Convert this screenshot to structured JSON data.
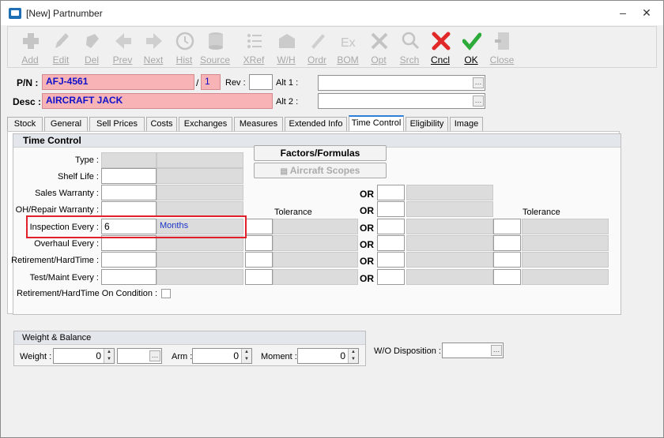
{
  "window": {
    "title": "[New] Partnumber"
  },
  "toolbar": {
    "buttons": [
      {
        "label": "Add",
        "icon": "add-icon"
      },
      {
        "label": "Edit",
        "icon": "edit-icon"
      },
      {
        "label": "Del",
        "icon": "delete-icon"
      },
      {
        "label": "Prev",
        "icon": "prev-icon"
      },
      {
        "label": "Next",
        "icon": "next-icon"
      },
      {
        "label": "Hist",
        "icon": "history-icon"
      },
      {
        "label": "Source",
        "icon": "source-icon"
      },
      {
        "label": "XRef",
        "icon": "xref-icon"
      },
      {
        "label": "W/H",
        "icon": "warehouse-icon"
      },
      {
        "label": "Ordr",
        "icon": "order-icon"
      },
      {
        "label": "BOM",
        "icon": "bom-icon"
      },
      {
        "label": "Opt",
        "icon": "options-icon"
      },
      {
        "label": "Srch",
        "icon": "search-icon"
      },
      {
        "label": "Cncl",
        "icon": "cancel-icon"
      },
      {
        "label": "OK",
        "icon": "ok-icon"
      },
      {
        "label": "Close",
        "icon": "close-door-icon"
      }
    ]
  },
  "header": {
    "pn_label": "P/N :",
    "pn_value": "AFJ-4561",
    "slash": "/",
    "pn_suffix": "1",
    "rev_label": "Rev :",
    "rev_value": "",
    "alt1_label": "Alt 1 :",
    "alt1_value": "",
    "desc_label": "Desc :",
    "desc_value": "AIRCRAFT JACK",
    "alt2_label": "Alt 2 :",
    "alt2_value": ""
  },
  "tabs": [
    "Stock",
    "General",
    "Sell Prices",
    "Costs",
    "Exchanges",
    "Measures",
    "Extended Info",
    "Time Control",
    "Eligibility",
    "Image"
  ],
  "active_tab": "Time Control",
  "time_control": {
    "group_title": "Time Control",
    "factors_button": "Factors/Formulas",
    "aircraft_scopes_button": "Aircraft Scopes",
    "tolerance_label_1": "Tolerance",
    "tolerance_label_2": "Tolerance",
    "or_label": "OR",
    "rows": [
      {
        "label": "Type :",
        "value": "",
        "unit": ""
      },
      {
        "label": "Shelf Life :",
        "value": "",
        "unit": ""
      },
      {
        "label": "Sales Warranty :",
        "value": "",
        "unit": ""
      },
      {
        "label": "OH/Repair Warranty :",
        "value": "",
        "unit": ""
      },
      {
        "label": "Inspection Every :",
        "value": "6",
        "unit": "Months"
      },
      {
        "label": "Overhaul Every :",
        "value": "",
        "unit": ""
      },
      {
        "label": "Retirement/HardTime :",
        "value": "",
        "unit": ""
      },
      {
        "label": "Test/Maint Every :",
        "value": "",
        "unit": ""
      }
    ],
    "on_condition_label": "Retirement/HardTime On Condition :"
  },
  "weight_balance": {
    "title": "Weight & Balance",
    "weight_label": "Weight :",
    "weight_value": "0",
    "arm_label": "Arm :",
    "arm_value": "0",
    "moment_label": "Moment :",
    "moment_value": "0"
  },
  "wo_disposition": {
    "label": "W/O Disposition :",
    "value": ""
  }
}
